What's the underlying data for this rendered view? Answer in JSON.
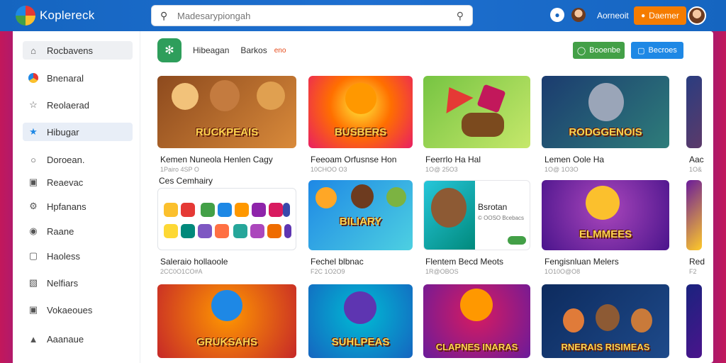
{
  "app": {
    "logo_text": "Koplereck"
  },
  "search": {
    "placeholder": "Madesarypiongah"
  },
  "header": {
    "user_label": "Aorneoit",
    "action_button": "Daemer"
  },
  "sidebar": {
    "items": [
      {
        "label": "Rocbavens",
        "icon": "home-icon"
      },
      {
        "label": "Bnenaral",
        "icon": "color-wheel-icon"
      },
      {
        "label": "Reolaerad",
        "icon": "star-outline-icon"
      },
      {
        "label": "Hibugar",
        "icon": "star-icon"
      },
      {
        "label": "Doroean.",
        "icon": "circle-icon"
      },
      {
        "label": "Reaevac",
        "icon": "folder-icon"
      },
      {
        "label": "Hpfanans",
        "icon": "gear-icon"
      },
      {
        "label": "Raane",
        "icon": "location-icon"
      },
      {
        "label": "Haoless",
        "icon": "box-icon"
      },
      {
        "label": "Nelfiars",
        "icon": "bag-icon"
      },
      {
        "label": "Vokaeoues",
        "icon": "briefcase-icon"
      },
      {
        "label": "Aaanaue",
        "icon": "person-icon"
      }
    ]
  },
  "main": {
    "tabs": [
      "Hibeagan",
      "Barkos"
    ],
    "tag": "eno",
    "green_button": "Booenbe",
    "blue_button": "Becroes",
    "section_label": "Ces Cemhairy"
  },
  "cards": [
    {
      "art_text": "RUCKPEAIS",
      "title": "Kemen Nuneola Henlen Cagy",
      "sub": "1Pairo 4SP O",
      "palette": [
        "#8d4a1e",
        "#d98a3a"
      ]
    },
    {
      "art_text": "BUSBERS",
      "title": "Feeoam Orfusnse Hon",
      "sub": "10CHOO O3",
      "palette": [
        "#ff6f00",
        "#e91e63"
      ]
    },
    {
      "art_text": "",
      "title": "Feerrlo Ha Hal",
      "sub": "1O@ 25O3",
      "palette": [
        "#76c442",
        "#c6e86b"
      ]
    },
    {
      "art_text": "RODGGENOIS",
      "title": "Lemen Oole Ha",
      "sub": "1O@ 1O3O",
      "palette": [
        "#1b3b6f",
        "#2e7d7a"
      ]
    },
    {
      "art_text": "",
      "title": "Aac",
      "sub": "1O&",
      "palette": [
        "#2a3d80",
        "#5c3a6a"
      ]
    },
    {
      "art_text": "",
      "title": "Saleraio hollaoole",
      "sub": "2CC0O1CO#A",
      "palette": [
        "#ffffff",
        "#ffffff"
      ]
    },
    {
      "art_text": "BILIARY",
      "title": "Fechel blbnac",
      "sub": "F2C 1O2O9",
      "palette": [
        "#1e88e5",
        "#4dd0e1"
      ]
    },
    {
      "art_text": "",
      "title": "Flentem Becd Meots",
      "sub": "1R@OBOS",
      "palette": [
        "#ffffff",
        "#ffffff"
      ]
    },
    {
      "art_text": "ELMMEES",
      "title": "Fengisnluan Melers",
      "sub": "1O10O@O8",
      "palette": [
        "#4a148c",
        "#8e24aa"
      ]
    },
    {
      "art_text": "",
      "title": "Red",
      "sub": "F2",
      "palette": [
        "#6a1b9a",
        "#ffca28"
      ]
    },
    {
      "art_text": "GRUKSAHS",
      "title": "",
      "sub": "",
      "palette": [
        "#c62828",
        "#ff9800"
      ]
    },
    {
      "art_text": "SUHLPEAS",
      "title": "",
      "sub": "",
      "palette": [
        "#1565c0",
        "#00bcd4"
      ]
    },
    {
      "art_text": "CLAPNES INARAS",
      "title": "",
      "sub": "",
      "palette": [
        "#6a1b9a",
        "#d81b60"
      ]
    },
    {
      "art_text": "RNERAIS RISIMEAS",
      "title": "",
      "sub": "",
      "palette": [
        "#0d2b5e",
        "#1e4a8a"
      ]
    },
    {
      "art_text": "",
      "title": "",
      "sub": "",
      "palette": [
        "#1a237e",
        "#4a148c"
      ]
    }
  ],
  "featured_card": {
    "label": "Bsrotan",
    "sub": "© OOSO Bcebacs"
  },
  "colors": {
    "topbar": "#1565c0",
    "accent_orange": "#f57c00",
    "green": "#43a047",
    "blue": "#1e88e5"
  }
}
